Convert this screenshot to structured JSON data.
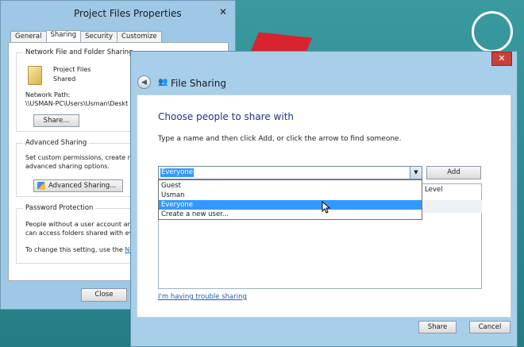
{
  "back_window": {
    "title": "Project Files Properties",
    "close_label": "✕",
    "tabs": [
      {
        "label": "General"
      },
      {
        "label": "Sharing"
      },
      {
        "label": "Security"
      },
      {
        "label": "Customize"
      }
    ],
    "network_section": {
      "title": "Network File and Folder Sharing",
      "folder_name": "Project Files",
      "folder_status": "Shared",
      "network_path_label": "Network Path:",
      "network_path": "\\\\USMAN-PC\\Users\\Usman\\Deskt",
      "share_button": "Share..."
    },
    "advanced_section": {
      "title": "Advanced Sharing",
      "desc_line1": "Set custom permissions, create mult",
      "desc_line2": "advanced sharing options.",
      "button": "Advanced Sharing..."
    },
    "password_section": {
      "title": "Password Protection",
      "line1": "People without a user account and",
      "line2": "can access folders shared with eve",
      "line3_prefix": "To change this setting, use the",
      "line3_link": "Net"
    },
    "close_button": "Close"
  },
  "dialog": {
    "title": "File Sharing",
    "close_label": "✕",
    "heading": "Choose people to share with",
    "instruction": "Type a name and then click Add, or click the arrow to find someone.",
    "combo_value": "Everyone",
    "add_button": "Add",
    "column_level": "Level",
    "dropdown_items": [
      {
        "label": "Guest",
        "selected": false
      },
      {
        "label": "Usman",
        "selected": false
      },
      {
        "label": "Everyone",
        "selected": true
      },
      {
        "label": "Create a new user...",
        "selected": false
      }
    ],
    "trouble_link": "I'm having trouble sharing",
    "share_button": "Share",
    "cancel_button": "Cancel"
  },
  "colors": {
    "desktop": "#2e8a8e",
    "window_frame": "#a7cfea",
    "selection": "#3399ff",
    "heading_blue": "#1e3287",
    "close_red": "#c7403a"
  }
}
